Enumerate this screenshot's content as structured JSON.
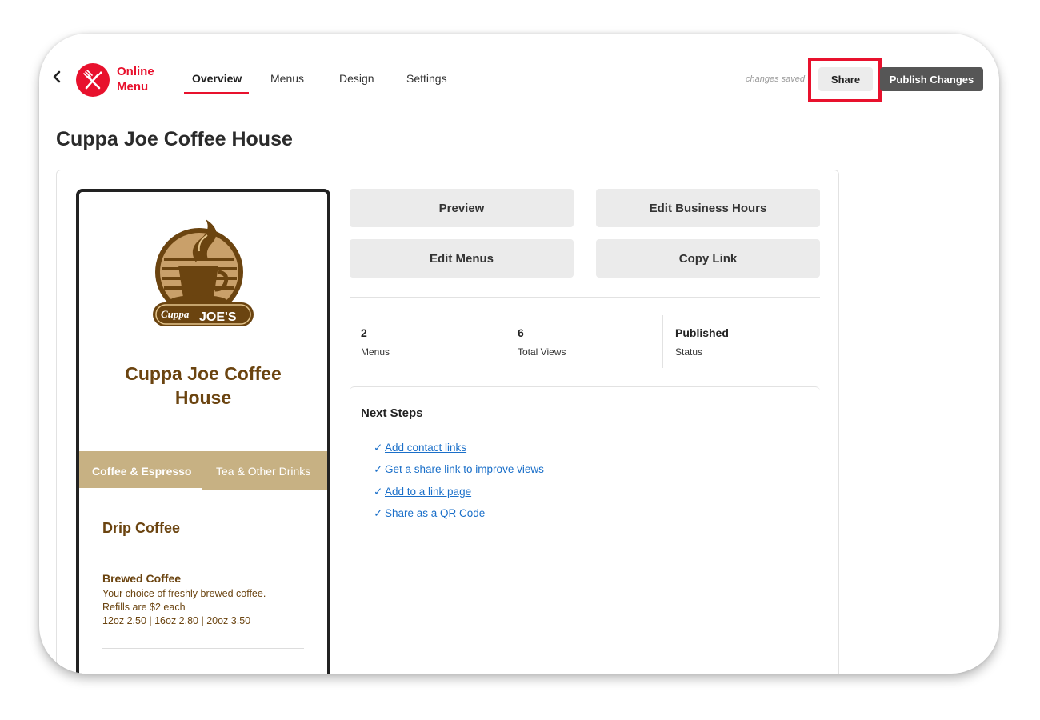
{
  "header": {
    "brand": [
      "Online",
      "Menu"
    ],
    "nav": [
      {
        "label": "Overview",
        "active": true
      },
      {
        "label": "Menus",
        "active": false
      },
      {
        "label": "Design",
        "active": false
      },
      {
        "label": "Settings",
        "active": false
      }
    ],
    "status": "changes saved",
    "share_label": "Share",
    "publish_label": "Publish Changes"
  },
  "page": {
    "title": "Cuppa Joe Coffee House"
  },
  "preview": {
    "logo_text_left": "Cuppa",
    "logo_text_right": "JOE'S",
    "business_name": [
      "Cuppa Joe Coffee",
      "House"
    ],
    "tabs": [
      "Coffee & Espresso",
      "Tea & Other Drinks"
    ],
    "section": "Drip Coffee",
    "item": {
      "name": "Brewed Coffee",
      "lines": [
        "Your choice of freshly brewed coffee.",
        "Refills are $2 each",
        "12oz 2.50 | 16oz 2.80 | 20oz 3.50"
      ]
    }
  },
  "actions": [
    "Preview",
    "Edit Business Hours",
    "Edit Menus",
    "Copy Link"
  ],
  "stats": [
    {
      "value": "2",
      "label": "Menus"
    },
    {
      "value": "6",
      "label": "Total Views"
    },
    {
      "value": "Published",
      "label": "Status"
    }
  ],
  "next_steps": {
    "title": "Next Steps",
    "items": [
      "Add contact links",
      "Get a share link to improve views",
      "Add to a link page",
      "Share as a QR Code"
    ]
  },
  "colors": {
    "brand_red": "#e8112d",
    "coffee_brown": "#6b4410",
    "tab_tan": "#c7b183",
    "link_blue": "#1a6fc9"
  },
  "icons": {
    "back": "chevron-left-icon",
    "logo": "fork-knife-icon",
    "step": "check-icon"
  }
}
